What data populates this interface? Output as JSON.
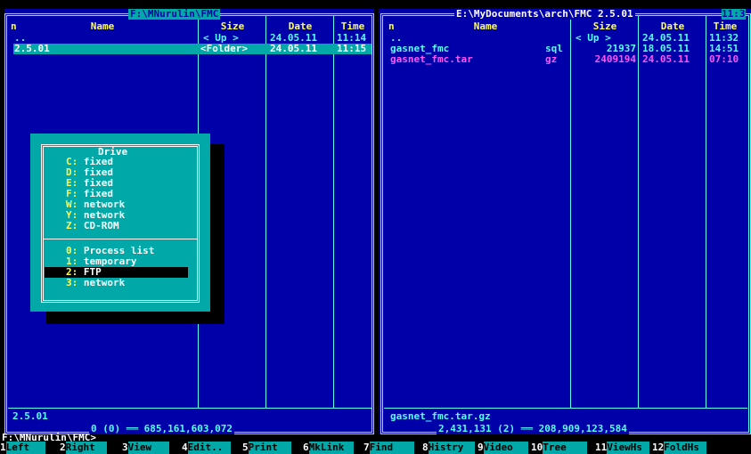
{
  "left_panel": {
    "path": "F:\\MNurulin\\FMC",
    "headers": {
      "name_col": "n",
      "name": "Name",
      "size": "Size",
      "date": "Date",
      "time": "Time"
    },
    "rows": [
      {
        "name": "..",
        "size": "< Up >",
        "date": "24.05.11",
        "time": "11:14"
      },
      {
        "name": "2.5.01",
        "size": "<Folder>",
        "date": "24.05.11",
        "time": "11:15"
      }
    ],
    "current_name": "2.5.01",
    "summary": "0 (0) ══ 685,161,603,072"
  },
  "right_panel": {
    "path": "E:\\MyDocuments\\arch\\FMC 2.5.01",
    "clock": "11:3",
    "headers": {
      "name_col": "n",
      "name": "Name",
      "size": "Size",
      "date": "Date",
      "time": "Time"
    },
    "rows": [
      {
        "name": "..",
        "ext": "",
        "size": "< Up >",
        "date": "24.05.11",
        "time": "11:32"
      },
      {
        "name": "gasnet_fmc",
        "ext": "sql",
        "size": "21937",
        "date": "18.05.11",
        "time": "14:51"
      },
      {
        "name": "gasnet_fmc.tar",
        "ext": "gz",
        "size": "2409194",
        "date": "24.05.11",
        "time": "07:10"
      }
    ],
    "current_name": "gasnet_fmc.tar.gz",
    "summary": "2,431,131 (2) ══ 208,909,123,584"
  },
  "drive_menu": {
    "title": "Drive",
    "items": [
      {
        "key": "C:",
        "label": "fixed"
      },
      {
        "key": "D:",
        "label": "fixed"
      },
      {
        "key": "E:",
        "label": "fixed"
      },
      {
        "key": "F:",
        "label": "fixed"
      },
      {
        "key": "W:",
        "label": "network"
      },
      {
        "key": "Y:",
        "label": "network"
      },
      {
        "key": "Z:",
        "label": "CD-ROM"
      }
    ],
    "extra": [
      {
        "key": "0:",
        "label": "Process list"
      },
      {
        "key": "1:",
        "label": "temporary"
      },
      {
        "key": "2:",
        "label": "FTP"
      },
      {
        "key": "3:",
        "label": "network"
      }
    ],
    "selected_index": 2
  },
  "command_line": "F:\\MNurulin\\FMC>",
  "fkeys": [
    {
      "num": "1",
      "label": "Left"
    },
    {
      "num": "2",
      "label": "Right"
    },
    {
      "num": "3",
      "label": "View"
    },
    {
      "num": "4",
      "label": "Edit.."
    },
    {
      "num": "5",
      "label": "Print"
    },
    {
      "num": "6",
      "label": "MkLink"
    },
    {
      "num": "7",
      "label": "Find"
    },
    {
      "num": "8",
      "label": "Histry"
    },
    {
      "num": "9",
      "label": "Video"
    },
    {
      "num": "10",
      "label": "Tree"
    },
    {
      "num": "11",
      "label": "ViewHs"
    },
    {
      "num": "12",
      "label": "FoldHs"
    }
  ],
  "colors": {
    "panel_bg": "#0000a8",
    "frame": "#55ffff",
    "header": "#ffff55",
    "selection": "#00a8a8",
    "archive": "#ff55ff",
    "menu_bg": "#00a8a8"
  }
}
